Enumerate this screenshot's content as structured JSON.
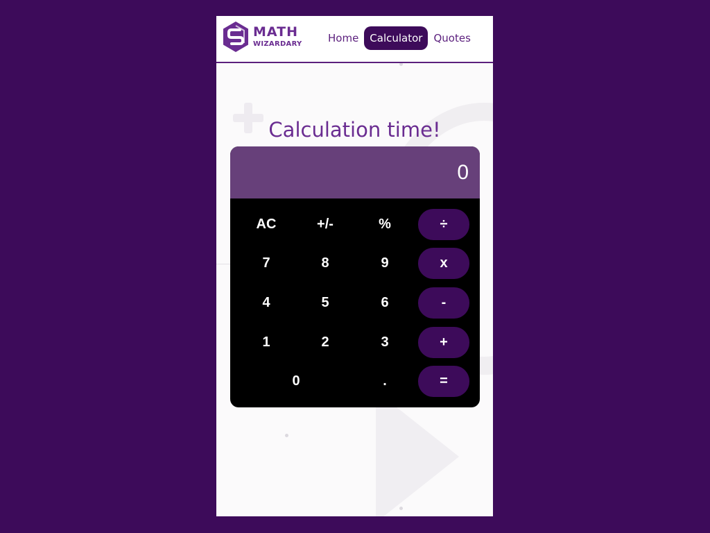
{
  "brand": {
    "line1": "MATH",
    "line2": "WIZARDARY"
  },
  "nav": {
    "items": [
      {
        "label": "Home",
        "active": false
      },
      {
        "label": "Calculator",
        "active": true
      },
      {
        "label": "Quotes",
        "active": false
      }
    ]
  },
  "page": {
    "title": "Calculation time!"
  },
  "calculator": {
    "display": "0",
    "keys": {
      "ac": "AC",
      "sign": "+/-",
      "percent": "%",
      "divide": "÷",
      "seven": "7",
      "eight": "8",
      "nine": "9",
      "multiply": "x",
      "four": "4",
      "five": "5",
      "six": "6",
      "subtract": "-",
      "one": "1",
      "two": "2",
      "three": "3",
      "add": "+",
      "zero": "0",
      "decimal": ".",
      "equals": "="
    }
  },
  "colors": {
    "page_bg": "#3d0b5a",
    "accent": "#6a2c91",
    "display_bg": "#67407a",
    "operator_bg": "#3d0b5a",
    "keypad_bg": "#000000"
  }
}
